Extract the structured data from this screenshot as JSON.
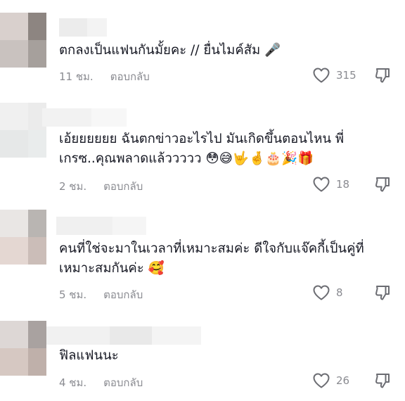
{
  "comments": [
    {
      "text": "ตกลงเป็นแฟนกันมั้ยคะ // ยื่นไมค์สัม 🎤",
      "time": "11 ชม.",
      "reply_label": "ตอบกลับ",
      "likes": "315"
    },
    {
      "text": "เอ้ยยยยยย ฉันตกข่าวอะไรไป มันเกิดขึ้นตอนไหน พี่เกรซ..คุณพลาดแล้ววววว 😳😅🤟🤞🎂🎉🎁",
      "time": "2 ชม.",
      "reply_label": "ตอบกลับ",
      "likes": "18"
    },
    {
      "text": "คนที่ใช่จะมาในเวลาที่เหมาะสมค่ะ ดีใจกับแจ๊คกี้เป็นคู่ที่เหมาะสมกันค่ะ 🥰",
      "time": "5 ชม.",
      "reply_label": "ตอบกลับ",
      "likes": "8"
    },
    {
      "text": "ฟิลแฟนนะ",
      "time": "4 ชม.",
      "reply_label": "ตอบกลับ",
      "likes": "26"
    }
  ],
  "icons": {
    "like": "heart-outline-icon",
    "dislike": "thumbs-down-icon"
  },
  "colors": {
    "text": "#161823",
    "meta": "#8a8b91",
    "icon": "#6b6c72"
  }
}
